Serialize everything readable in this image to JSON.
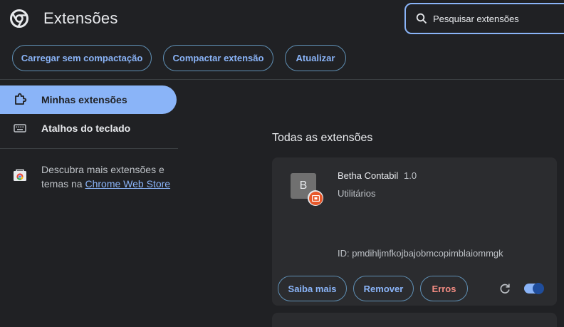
{
  "header": {
    "title": "Extensões",
    "search_placeholder": "Pesquisar extensões"
  },
  "toolbar": {
    "load_unpacked": "Carregar sem compactação",
    "pack_extension": "Compactar extensão",
    "update": "Atualizar"
  },
  "sidebar": {
    "items": [
      {
        "label": "Minhas extensões",
        "icon": "puzzle-icon",
        "active": true
      },
      {
        "label": "Atalhos do teclado",
        "icon": "keyboard-icon",
        "active": false
      }
    ],
    "store_text": "Descubra mais extensões e temas na ",
    "store_link": "Chrome Web Store"
  },
  "main": {
    "section_title": "Todas as extensões",
    "extension": {
      "icon_letter": "B",
      "name": "Betha Contabil",
      "version": "1.0",
      "description": "Utilitários",
      "id_text": "ID: pmdihljmfkojbajobmcopimblaiommgk",
      "enabled": true,
      "buttons": {
        "details": "Saiba mais",
        "remove": "Remover",
        "errors": "Erros"
      }
    }
  },
  "colors": {
    "background": "#202124",
    "accent": "#8ab4f8",
    "card": "#2b2c2f",
    "error": "#f28b82",
    "badge": "#e8582a"
  }
}
